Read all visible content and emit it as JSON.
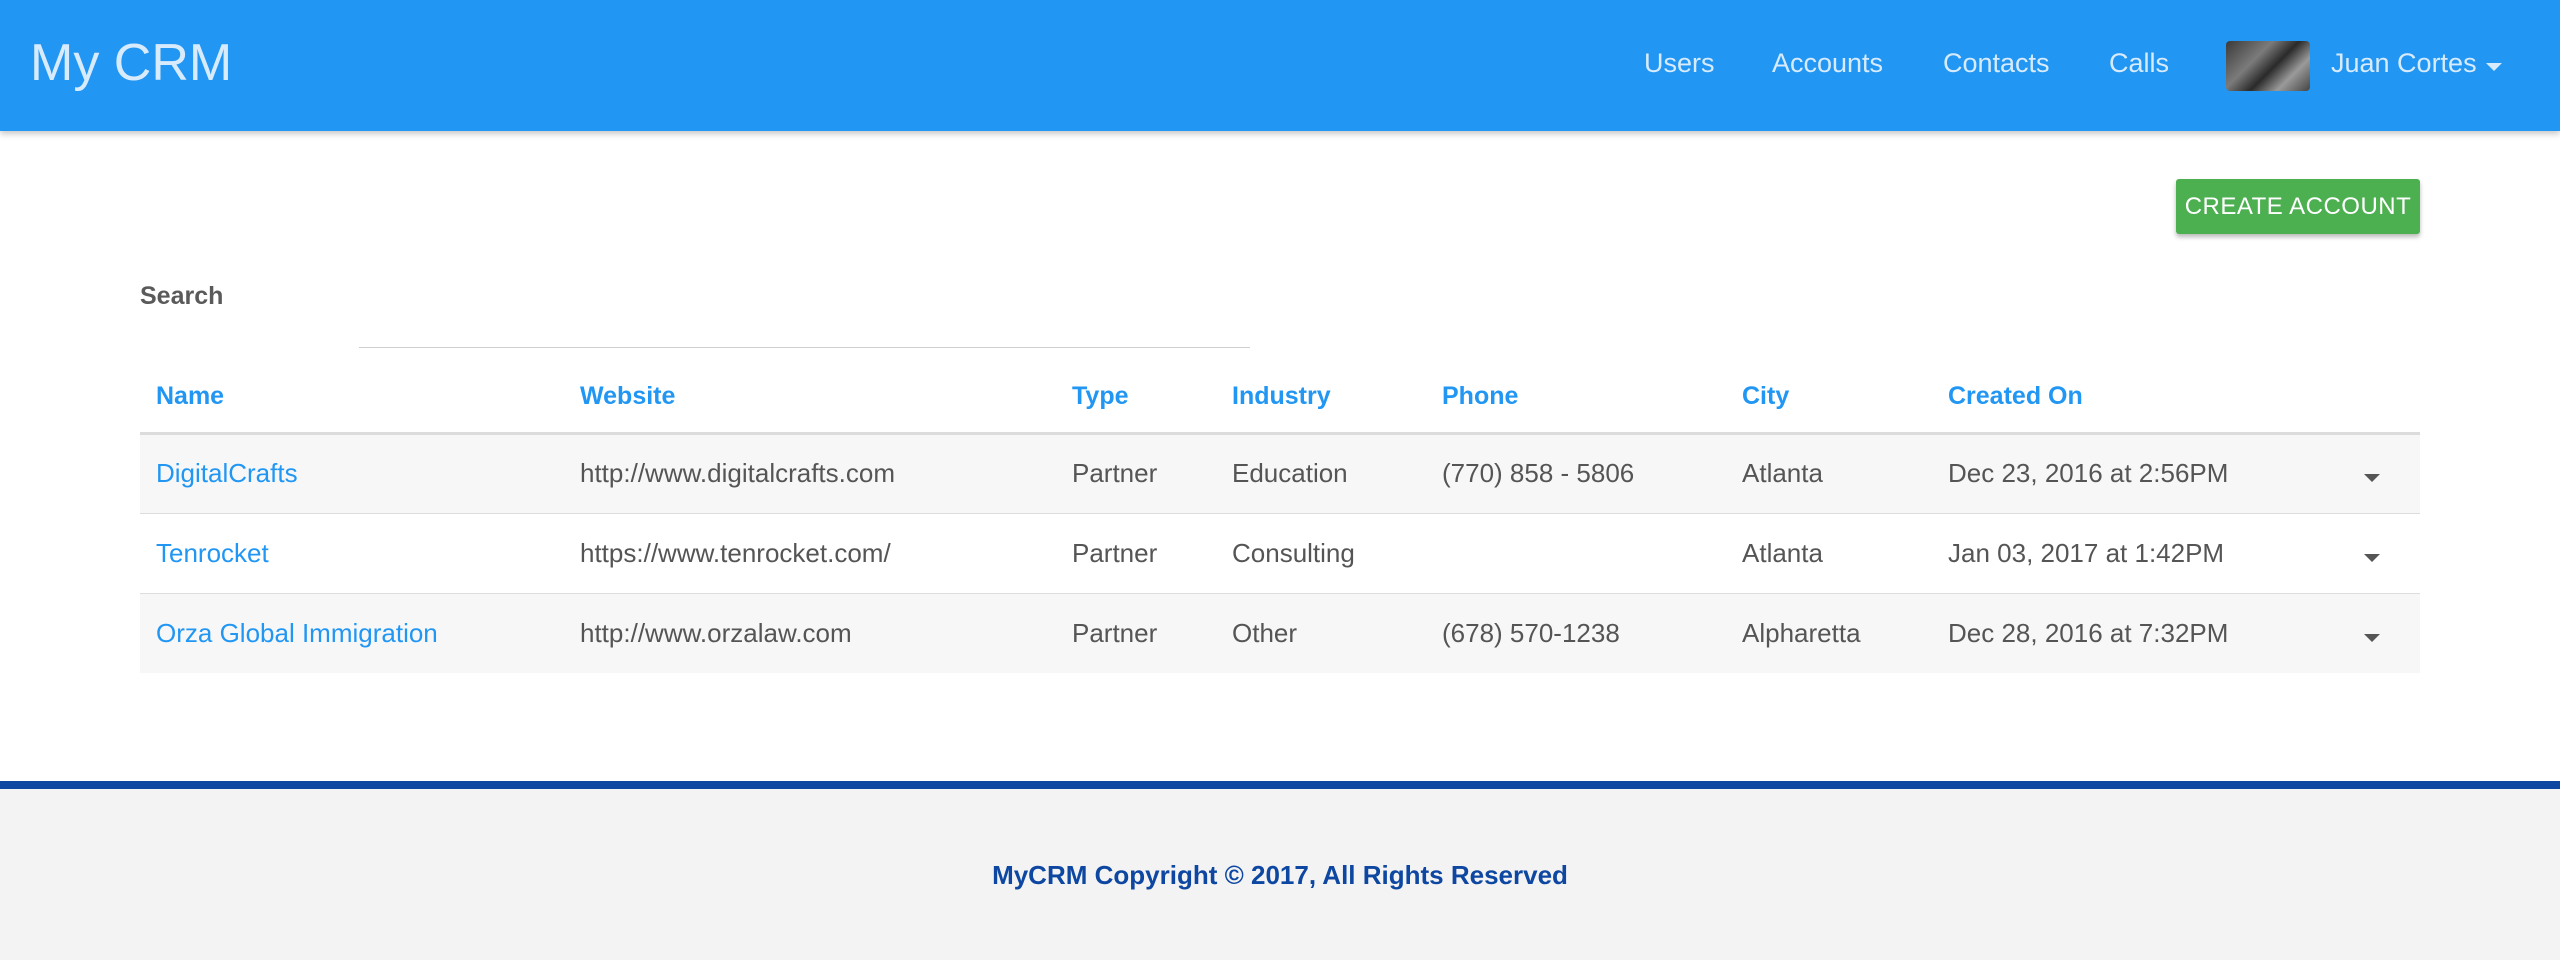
{
  "app": {
    "brand": "My CRM"
  },
  "nav": {
    "users": "Users",
    "accounts": "Accounts",
    "contacts": "Contacts",
    "calls": "Calls",
    "user_name": "Juan Cortes"
  },
  "actions": {
    "create_account": "CREATE ACCOUNT"
  },
  "search": {
    "label": "Search",
    "value": "",
    "placeholder": ""
  },
  "table": {
    "headers": [
      "Name",
      "Website",
      "Type",
      "Industry",
      "Phone",
      "City",
      "Created On"
    ],
    "rows": [
      {
        "name": "DigitalCrafts",
        "website": "http://www.digitalcrafts.com",
        "type": "Partner",
        "industry": "Education",
        "phone": "(770) 858 - 5806",
        "city": "Atlanta",
        "created_on": "Dec 23, 2016 at 2:56PM"
      },
      {
        "name": "Tenrocket",
        "website": "https://www.tenrocket.com/",
        "type": "Partner",
        "industry": "Consulting",
        "phone": "",
        "city": "Atlanta",
        "created_on": "Jan 03, 2017 at 1:42PM"
      },
      {
        "name": "Orza Global Immigration",
        "website": "http://www.orzalaw.com",
        "type": "Partner",
        "industry": "Other",
        "phone": "(678) 570-1238",
        "city": "Alpharetta",
        "created_on": "Dec 28, 2016 at 7:32PM"
      }
    ]
  },
  "footer": {
    "text": "MyCRM Copyright © 2017, All Rights Reserved"
  },
  "colors": {
    "primary": "#2196f3",
    "success": "#4caf50",
    "footer_accent": "#0d47a1"
  }
}
